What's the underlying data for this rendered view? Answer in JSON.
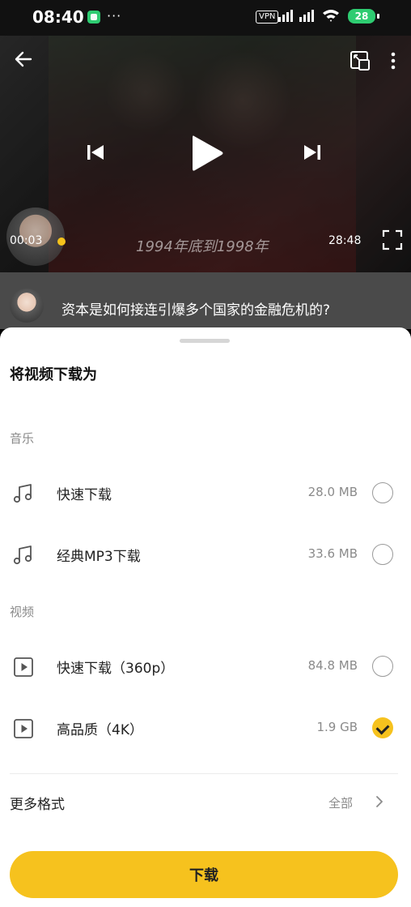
{
  "status_bar": {
    "time": "08:40",
    "dots": "···",
    "vpn": "VPN",
    "battery": "28"
  },
  "player": {
    "current_time": "00:03",
    "total_time": "28:48",
    "subtitle": "1994年底到1998年",
    "progress_fraction": 0.002
  },
  "video_info": {
    "title": "资本是如何接连引爆多个国家的金融危机的?"
  },
  "sheet": {
    "title": "将视频下载为",
    "music_section": "音乐",
    "video_section": "视频",
    "options": [
      {
        "label": "快速下载",
        "size": "28.0 MB",
        "icon": "music-note-icon",
        "selected": false
      },
      {
        "label": "经典MP3下载",
        "size": "33.6 MB",
        "icon": "music-note-icon",
        "selected": false
      },
      {
        "label": "快速下载（360p）",
        "size": "84.8 MB",
        "icon": "video-play-icon",
        "selected": false
      },
      {
        "label": "高品质（4K）",
        "size": "1.9 GB",
        "icon": "video-play-icon",
        "selected": true
      }
    ],
    "more_formats_label": "更多格式",
    "more_formats_value": "全部",
    "download_button": "下载"
  },
  "colors": {
    "accent": "#f6c21e",
    "battery": "#2ecc71"
  }
}
